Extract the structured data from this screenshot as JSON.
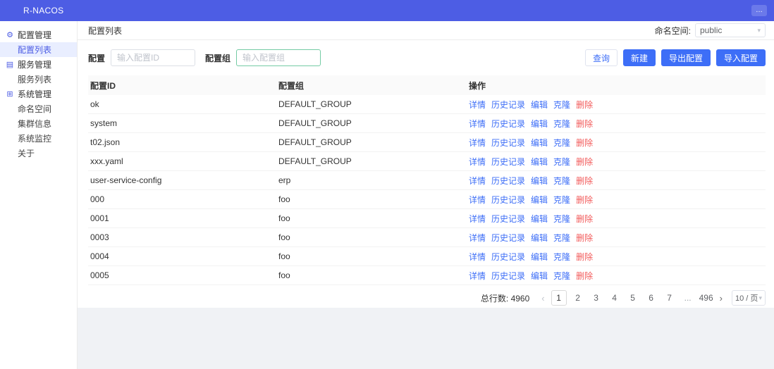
{
  "header": {
    "brand": "R-NACOS",
    "more_button": "…"
  },
  "sidebar": {
    "items": [
      {
        "label": "配置管理",
        "type": "group",
        "icon": "gear-icon",
        "icon_glyph": "⚙"
      },
      {
        "label": "配置列表",
        "type": "child",
        "active": true
      },
      {
        "label": "服务管理",
        "type": "group",
        "icon": "document-icon",
        "icon_glyph": "▤"
      },
      {
        "label": "服务列表",
        "type": "child"
      },
      {
        "label": "系统管理",
        "type": "group",
        "icon": "grid-icon",
        "icon_glyph": "⊞"
      },
      {
        "label": "命名空间",
        "type": "child"
      },
      {
        "label": "集群信息",
        "type": "child"
      },
      {
        "label": "系统监控",
        "type": "child"
      },
      {
        "label": "关于",
        "type": "child"
      }
    ]
  },
  "topbar": {
    "title": "配置列表",
    "namespace_label": "命名空间:",
    "namespace_value": "public",
    "chevron_glyph": "▾"
  },
  "query_form": {
    "config_label": "配置",
    "config_placeholder": "输入配置ID",
    "group_label": "配置组",
    "group_placeholder": "输入配置组",
    "buttons": {
      "query": "查询",
      "create": "新建",
      "export": "导出配置",
      "import": "导入配置"
    }
  },
  "table": {
    "headers": [
      "配置ID",
      "配置组",
      "操作"
    ],
    "actions": [
      {
        "label": "详情",
        "name": "detail-link",
        "danger": false
      },
      {
        "label": "历史记录",
        "name": "history-link",
        "danger": false
      },
      {
        "label": "编辑",
        "name": "edit-link",
        "danger": false
      },
      {
        "label": "克隆",
        "name": "clone-link",
        "danger": false
      },
      {
        "label": "删除",
        "name": "delete-link",
        "danger": true
      }
    ],
    "rows": [
      {
        "config_id": "ok",
        "group": "DEFAULT_GROUP"
      },
      {
        "config_id": "system",
        "group": "DEFAULT_GROUP"
      },
      {
        "config_id": "t02.json",
        "group": "DEFAULT_GROUP"
      },
      {
        "config_id": "xxx.yaml",
        "group": "DEFAULT_GROUP"
      },
      {
        "config_id": "user-service-config",
        "group": "erp"
      },
      {
        "config_id": "000",
        "group": "foo"
      },
      {
        "config_id": "0001",
        "group": "foo"
      },
      {
        "config_id": "0003",
        "group": "foo"
      },
      {
        "config_id": "0004",
        "group": "foo"
      },
      {
        "config_id": "0005",
        "group": "foo"
      }
    ]
  },
  "pagination": {
    "total_label": "总行数: 4960",
    "prev_glyph": "‹",
    "next_glyph": "›",
    "pages": [
      "1",
      "2",
      "3",
      "4",
      "5",
      "6",
      "7",
      "...",
      "496"
    ],
    "active_page": "1",
    "page_size": "10 / 页",
    "chevron_glyph": "▾"
  },
  "colors": {
    "header_bg": "#4d5de4",
    "primary": "#3d6ef7",
    "danger": "#f25a5a",
    "active_item_bg": "#e9eeff",
    "focused_input_border": "#74cba4"
  }
}
